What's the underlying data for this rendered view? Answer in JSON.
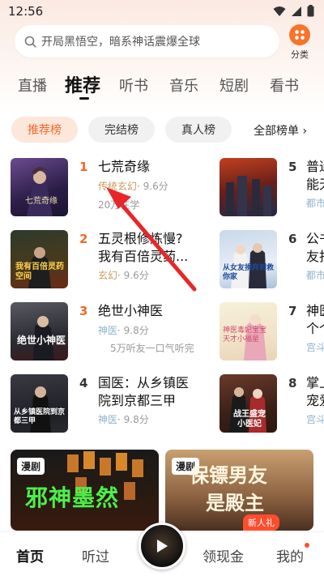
{
  "status": {
    "time": "12:56"
  },
  "search": {
    "placeholder": "开局黑悟空，暗系神话震爆全球",
    "category_label": "分类"
  },
  "tabs": [
    {
      "label": "直播"
    },
    {
      "label": "推荐"
    },
    {
      "label": "听书"
    },
    {
      "label": "音乐"
    },
    {
      "label": "短剧"
    },
    {
      "label": "看书"
    }
  ],
  "rank_chips": [
    {
      "label": "推荐榜"
    },
    {
      "label": "完结榜"
    },
    {
      "label": "真人榜"
    }
  ],
  "all_lists_label": "全部榜单 ›",
  "books_left": [
    {
      "rank": "1",
      "title": "七荒奇缘",
      "tag": "传统玄幻",
      "score": "· 9.6分",
      "readers": "20万在学",
      "cover_text": "七荒奇缘"
    },
    {
      "rank": "2",
      "title_line1": "五灵根修炼慢?",
      "title_line2": "我有百倍灵药...",
      "tag": "玄幻",
      "score": "· 9.6分",
      "cover_text": "我有百倍灵药空间"
    },
    {
      "rank": "3",
      "title": "绝世小神医",
      "tag": "神医",
      "score": "· 9.8分",
      "readers": "5万听友一口气听完",
      "cover_text": "绝世小神医"
    },
    {
      "rank": "4",
      "title_line1": "国医：从乡镇医",
      "title_line2": "院到京都三甲",
      "tag": "神医",
      "score": "· 9.8分",
      "cover_text": "从乡镇医院到京都三甲"
    }
  ],
  "books_right": [
    {
      "rank": "5",
      "title_line1": "普通",
      "title_line2": "能无",
      "tag": "都市"
    },
    {
      "rank": "6",
      "title_line1": "公书",
      "title_line2": "友捐",
      "tag": "都市",
      "cover_text": "从女友捐弃到救你家"
    },
    {
      "rank": "7",
      "title_line1": "神医",
      "title_line2": "个个",
      "tag": "宫斗",
      "cover_text": "神医毒妃宝宝天才小福星"
    },
    {
      "rank": "8",
      "title_line1": "掌上",
      "title_line2": "宠爱",
      "tag": "宫斗",
      "cover_text": "战王盛宠小医妃"
    }
  ],
  "banners": [
    {
      "badge": "漫剧",
      "title": "邪神墨然"
    },
    {
      "badge": "漫剧",
      "title_line1": "保镖男友",
      "title_line2": "是殿主"
    }
  ],
  "bottom_nav": [
    {
      "label": "首页"
    },
    {
      "label": "听过"
    },
    {
      "label": "领现金"
    },
    {
      "label": "我的"
    }
  ],
  "new_user_badge": "新人礼",
  "colors": {
    "accent": "#f2692a",
    "arrow": "#e8262a",
    "rank_orange": "#f26a2a"
  }
}
